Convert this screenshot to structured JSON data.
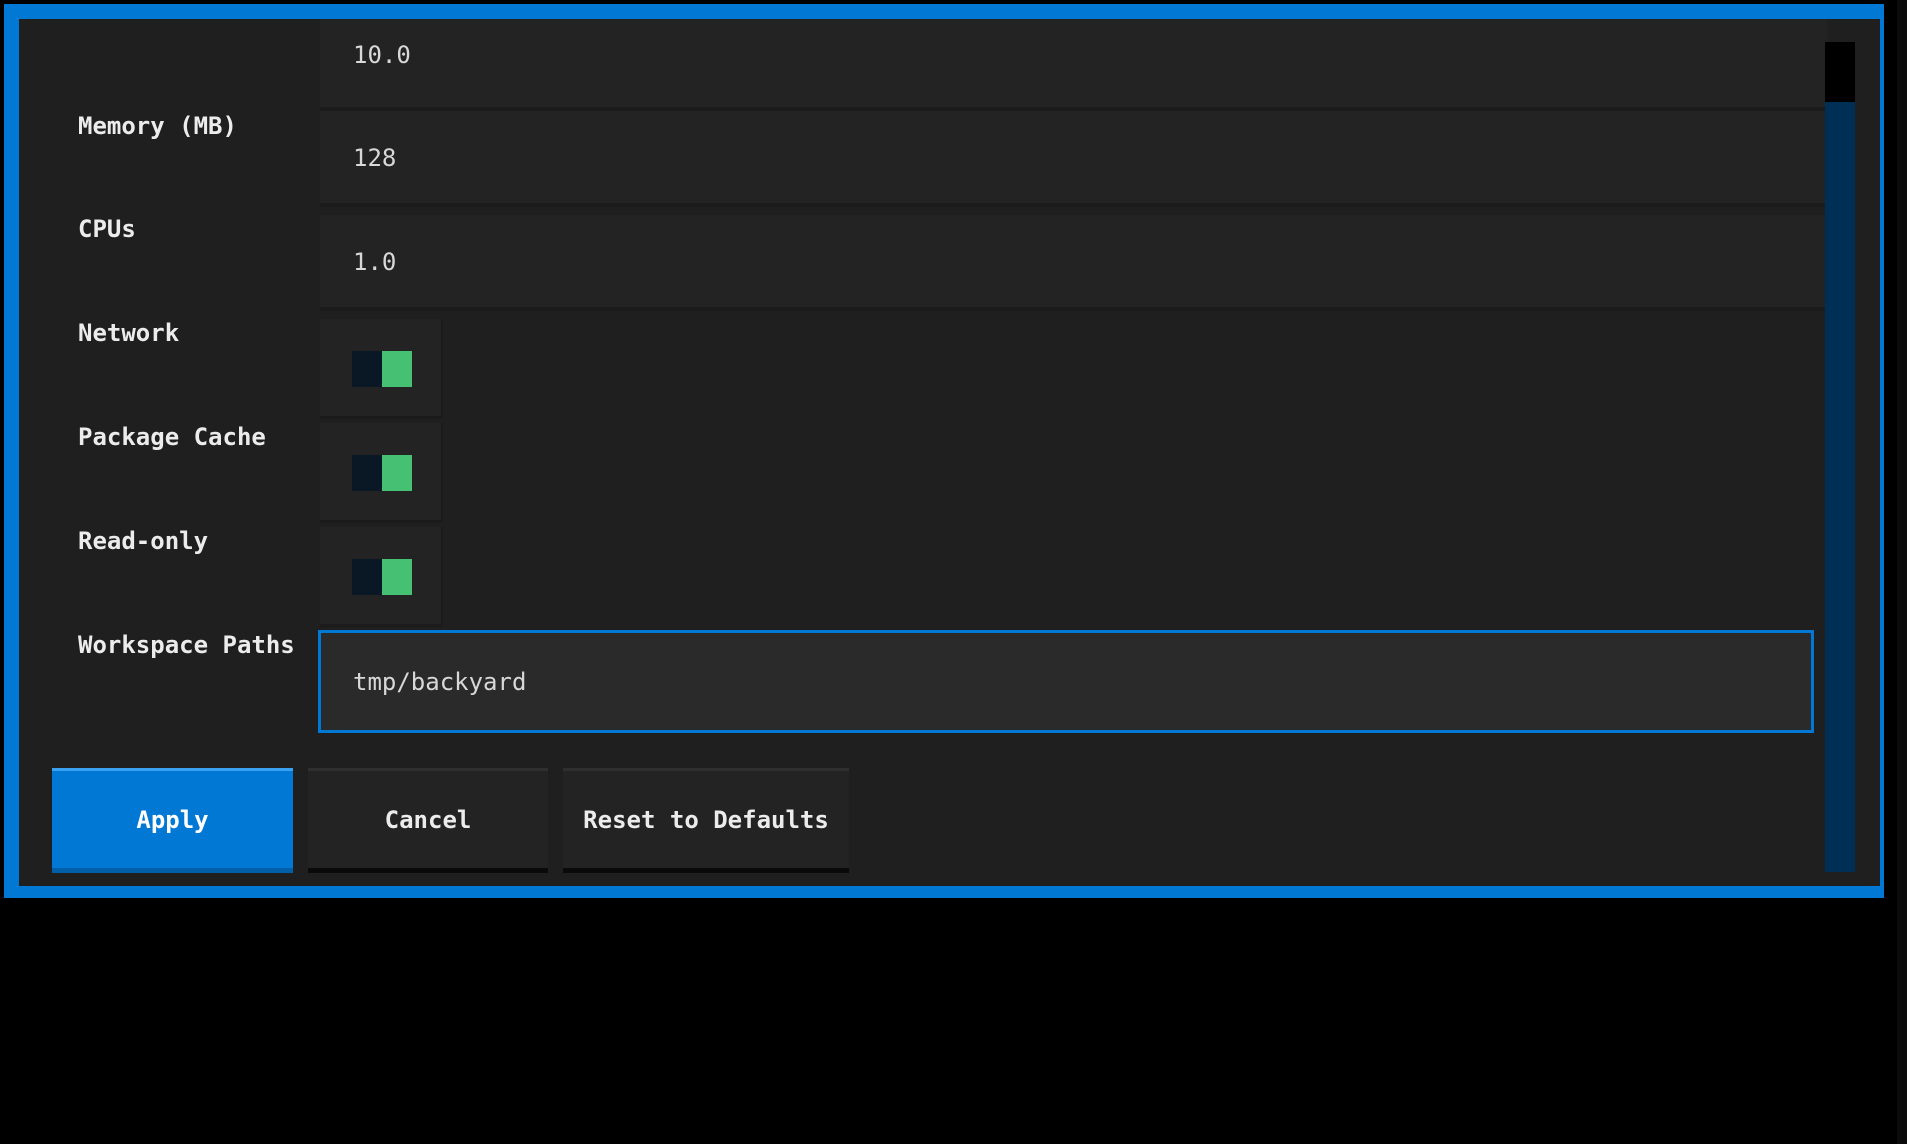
{
  "form": {
    "fields": [
      {
        "label": "",
        "value": "10.0"
      },
      {
        "label": "Memory (MB)",
        "value": "128"
      },
      {
        "label": "CPUs",
        "value": "1.0"
      }
    ],
    "toggles": [
      {
        "label": "Network",
        "on": true
      },
      {
        "label": "Package Cache",
        "on": true
      },
      {
        "label": "Read-only",
        "on": true
      }
    ],
    "workspace": {
      "label": "Workspace Paths",
      "value": "tmp/backyard"
    }
  },
  "buttons": {
    "apply": "Apply",
    "cancel": "Cancel",
    "reset": "Reset to Defaults"
  },
  "colors": {
    "accent": "#0178d4",
    "toggle_on": "#46c072",
    "panel_bg": "#1f1f1f"
  }
}
